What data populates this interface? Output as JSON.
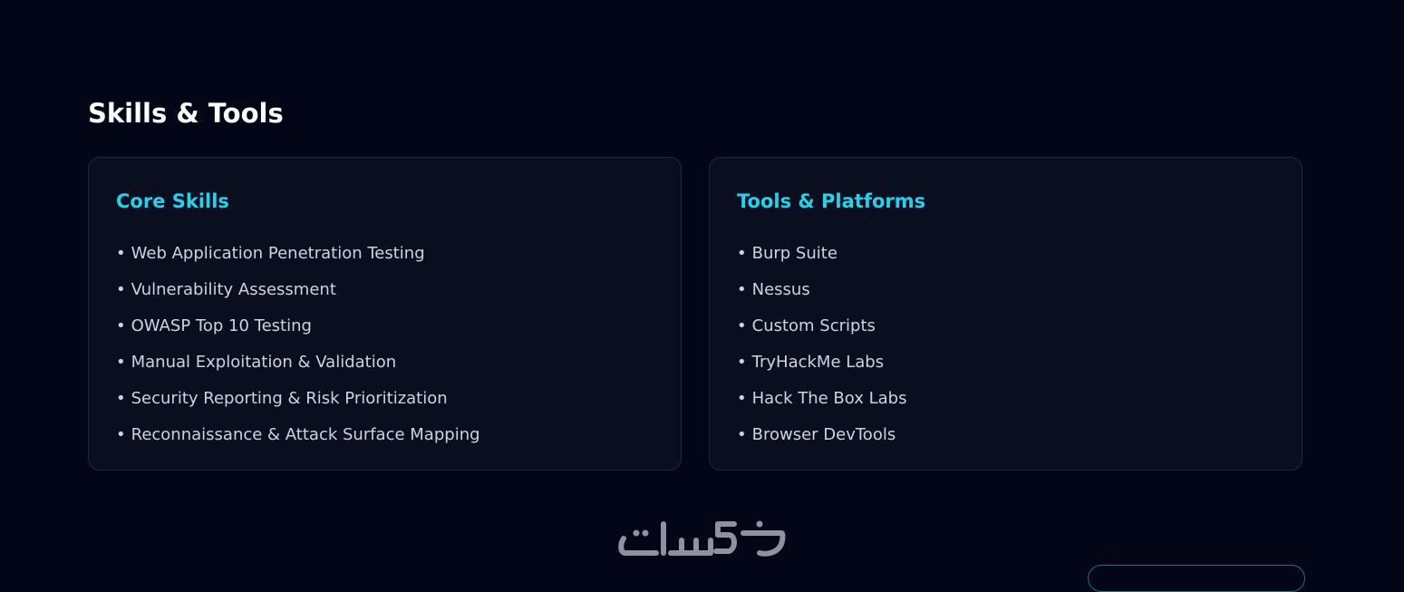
{
  "section": {
    "title": "Skills & Tools"
  },
  "cards": [
    {
      "title": "Core Skills",
      "bullet": "•",
      "items": [
        "Web Application Penetration Testing",
        "Vulnerability Assessment",
        "OWASP Top 10 Testing",
        "Manual Exploitation & Validation",
        "Security Reporting & Risk Prioritization",
        "Reconnaissance & Attack Surface Mapping"
      ]
    },
    {
      "title": "Tools & Platforms",
      "bullet": "•",
      "items": [
        "Burp Suite",
        "Nessus",
        "Custom Scripts",
        "TryHackMe Labs",
        "Hack The Box Labs",
        "Browser DevTools"
      ]
    }
  ],
  "watermark": {
    "text": "خمسات"
  },
  "colors": {
    "background": "#020617",
    "card_background": "#0a0f1f",
    "card_border": "#1e293b",
    "accent": "#22d3ee",
    "heading": "#ffffff",
    "body_text": "#cbd5e1",
    "watermark": "#9ca3af"
  }
}
